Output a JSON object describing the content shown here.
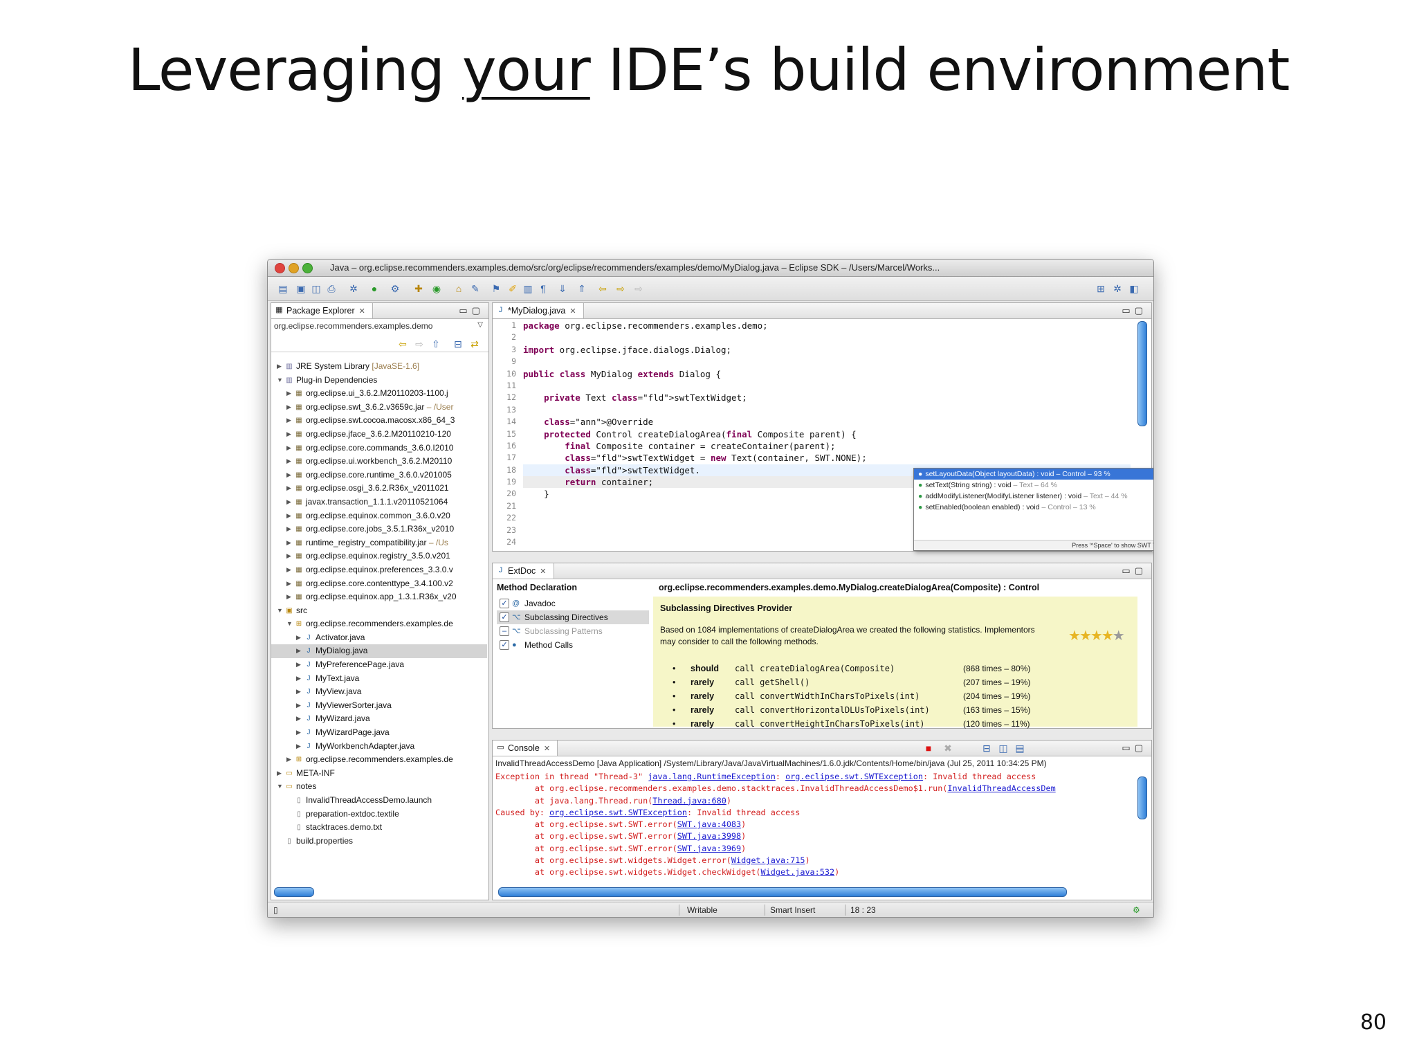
{
  "slide": {
    "title_before": "Leveraging ",
    "title_underlined": "your",
    "title_after": " IDE’s build environment",
    "page_number": "80"
  },
  "window": {
    "title": "Java – org.eclipse.recommenders.examples.demo/src/org/eclipse/recommenders/examples/demo/MyDialog.java – Eclipse SDK – /Users/Marcel/Works..."
  },
  "package_explorer": {
    "tab_label": "Package Explorer",
    "project": "org.eclipse.recommenders.examples.demo",
    "items": [
      {
        "label": "JRE System Library",
        "suffix": " [JavaSE-1.6]",
        "level": 0,
        "arrow": "▶",
        "icon": "library-icon"
      },
      {
        "label": "Plug-in Dependencies",
        "suffix": "",
        "level": 0,
        "arrow": "▼",
        "icon": "library-icon"
      },
      {
        "label": "org.eclipse.ui_3.6.2.M20110203-1100.j",
        "suffix": "",
        "level": 1,
        "arrow": "▶",
        "icon": "jar-icon"
      },
      {
        "label": "org.eclipse.swt_3.6.2.v3659c.jar",
        "suffix": " – /User",
        "level": 1,
        "arrow": "▶",
        "icon": "jar-icon"
      },
      {
        "label": "org.eclipse.swt.cocoa.macosx.x86_64_3",
        "suffix": "",
        "level": 1,
        "arrow": "▶",
        "icon": "jar-icon"
      },
      {
        "label": "org.eclipse.jface_3.6.2.M20110210-120",
        "suffix": "",
        "level": 1,
        "arrow": "▶",
        "icon": "jar-icon"
      },
      {
        "label": "org.eclipse.core.commands_3.6.0.I2010",
        "suffix": "",
        "level": 1,
        "arrow": "▶",
        "icon": "jar-icon"
      },
      {
        "label": "org.eclipse.ui.workbench_3.6.2.M20110",
        "suffix": "",
        "level": 1,
        "arrow": "▶",
        "icon": "jar-icon"
      },
      {
        "label": "org.eclipse.core.runtime_3.6.0.v201005",
        "suffix": "",
        "level": 1,
        "arrow": "▶",
        "icon": "jar-icon"
      },
      {
        "label": "org.eclipse.osgi_3.6.2.R36x_v2011021",
        "suffix": "",
        "level": 1,
        "arrow": "▶",
        "icon": "jar-icon"
      },
      {
        "label": "javax.transaction_1.1.1.v20110521064",
        "suffix": "",
        "level": 1,
        "arrow": "▶",
        "icon": "jar-icon"
      },
      {
        "label": "org.eclipse.equinox.common_3.6.0.v20",
        "suffix": "",
        "level": 1,
        "arrow": "▶",
        "icon": "jar-icon"
      },
      {
        "label": "org.eclipse.core.jobs_3.5.1.R36x_v2010",
        "suffix": "",
        "level": 1,
        "arrow": "▶",
        "icon": "jar-icon"
      },
      {
        "label": "runtime_registry_compatibility.jar",
        "suffix": " – /Us",
        "level": 1,
        "arrow": "▶",
        "icon": "jar-icon"
      },
      {
        "label": "org.eclipse.equinox.registry_3.5.0.v201",
        "suffix": "",
        "level": 1,
        "arrow": "▶",
        "icon": "jar-icon"
      },
      {
        "label": "org.eclipse.equinox.preferences_3.3.0.v",
        "suffix": "",
        "level": 1,
        "arrow": "▶",
        "icon": "jar-icon"
      },
      {
        "label": "org.eclipse.core.contenttype_3.4.100.v2",
        "suffix": "",
        "level": 1,
        "arrow": "▶",
        "icon": "jar-icon"
      },
      {
        "label": "org.eclipse.equinox.app_1.3.1.R36x_v20",
        "suffix": "",
        "level": 1,
        "arrow": "▶",
        "icon": "jar-icon"
      },
      {
        "label": "src",
        "suffix": "",
        "level": 0,
        "arrow": "▼",
        "icon": "source-folder-icon"
      },
      {
        "label": "org.eclipse.recommenders.examples.de",
        "suffix": "",
        "level": 1,
        "arrow": "▼",
        "icon": "package-icon"
      },
      {
        "label": "Activator.java",
        "suffix": "",
        "level": 2,
        "arrow": "▶",
        "icon": "java-file-icon"
      },
      {
        "label": "MyDialog.java",
        "suffix": "",
        "level": 2,
        "arrow": "▶",
        "icon": "java-file-icon",
        "selected": true
      },
      {
        "label": "MyPreferencePage.java",
        "suffix": "",
        "level": 2,
        "arrow": "▶",
        "icon": "java-file-icon"
      },
      {
        "label": "MyText.java",
        "suffix": "",
        "level": 2,
        "arrow": "▶",
        "icon": "java-file-icon"
      },
      {
        "label": "MyView.java",
        "suffix": "",
        "level": 2,
        "arrow": "▶",
        "icon": "java-file-icon"
      },
      {
        "label": "MyViewerSorter.java",
        "suffix": "",
        "level": 2,
        "arrow": "▶",
        "icon": "java-file-icon"
      },
      {
        "label": "MyWizard.java",
        "suffix": "",
        "level": 2,
        "arrow": "▶",
        "icon": "java-file-icon"
      },
      {
        "label": "MyWizardPage.java",
        "suffix": "",
        "level": 2,
        "arrow": "▶",
        "icon": "java-file-icon"
      },
      {
        "label": "MyWorkbenchAdapter.java",
        "suffix": "",
        "level": 2,
        "arrow": "▶",
        "icon": "java-file-icon"
      },
      {
        "label": "org.eclipse.recommenders.examples.de",
        "suffix": "",
        "level": 1,
        "arrow": "▶",
        "icon": "package-icon"
      },
      {
        "label": "META-INF",
        "suffix": "",
        "level": 0,
        "arrow": "▶",
        "icon": "folder-icon"
      },
      {
        "label": "notes",
        "suffix": "",
        "level": 0,
        "arrow": "▼",
        "icon": "folder-icon"
      },
      {
        "label": "InvalidThreadAccessDemo.launch",
        "suffix": "",
        "level": 1,
        "arrow": "",
        "icon": "file-icon"
      },
      {
        "label": "preparation-extdoc.textile",
        "suffix": "",
        "level": 1,
        "arrow": "",
        "icon": "file-icon"
      },
      {
        "label": "stacktraces.demo.txt",
        "suffix": "",
        "level": 1,
        "arrow": "",
        "icon": "file-icon"
      },
      {
        "label": "build.properties",
        "suffix": "",
        "level": 0,
        "arrow": "",
        "icon": "file-icon"
      }
    ]
  },
  "editor": {
    "tab_label": "*MyDialog.java",
    "line_numbers": [
      "1",
      "2",
      "3",
      "9",
      "10",
      "11",
      "12",
      "13",
      "14",
      "15",
      "16",
      "17",
      "18",
      "19",
      "20",
      "21",
      "22",
      "23",
      "24"
    ],
    "lines": [
      "package org.eclipse.recommenders.examples.demo;",
      "",
      "import org.eclipse.jface.dialogs.Dialog;",
      "",
      "public class MyDialog extends Dialog {",
      "",
      "    private Text swtTextWidget;",
      "",
      "    @Override",
      "    protected Control createDialogArea(final Composite parent) {",
      "        final Composite container = createContainer(parent);",
      "        swtTextWidget = new Text(container, SWT.NONE);",
      "        swtTextWidget.",
      "        return container;",
      "    }",
      "",
      "",
      "",
      ""
    ],
    "assist": {
      "items": [
        {
          "sig": "setLayoutData(Object layoutData) : void",
          "meta": " – Control – 93 %"
        },
        {
          "sig": "setText(String string) : void",
          "meta": " – Text – 64 %"
        },
        {
          "sig": "addModifyListener(ModifyListener listener) : void",
          "meta": " – Text – 44 %"
        },
        {
          "sig": "setEnabled(boolean enabled) : void",
          "meta": " – Control – 13 %"
        }
      ],
      "footer": "Press '^Space' to show SWT Template Proposals"
    }
  },
  "extdoc": {
    "tab_label": "ExtDoc",
    "method_declaration_label": "Method Declaration",
    "signature": "org.eclipse.recommenders.examples.demo.MyDialog.createDialogArea(Composite) : Control",
    "providers": [
      {
        "label": "Javadoc",
        "checked": true,
        "icon": "at-icon"
      },
      {
        "label": "Subclassing Directives",
        "checked": true,
        "icon": "tree-icon",
        "selected": true
      },
      {
        "label": "Subclassing Patterns",
        "checked": false,
        "icon": "tree-icon",
        "dim": true
      },
      {
        "label": "Method Calls",
        "checked": true,
        "icon": "dot-icon"
      }
    ],
    "provider_title": "Subclassing Directives Provider",
    "provider_text": "Based on 1084 implementations of createDialogArea we created the following statistics. Implementors may consider to call the following methods.",
    "rating": 4,
    "directives": [
      {
        "quantifier": "should",
        "call": "call createDialogArea(Composite)",
        "stats": "(868 times – 80%)"
      },
      {
        "quantifier": "rarely",
        "call": "call getShell()",
        "stats": "(207 times – 19%)"
      },
      {
        "quantifier": "rarely",
        "call": "call convertWidthInCharsToPixels(int)",
        "stats": "(204 times – 19%)"
      },
      {
        "quantifier": "rarely",
        "call": "call convertHorizontalDLUsToPixels(int)",
        "stats": "(163 times – 15%)"
      },
      {
        "quantifier": "rarely",
        "call": "call convertHeightInCharsToPixels(int)",
        "stats": "(120 times – 11%)"
      }
    ]
  },
  "console": {
    "tab_label": "Console",
    "header": "InvalidThreadAccessDemo [Java Application] /System/Library/Java/JavaVirtualMachines/1.6.0.jdk/Contents/Home/bin/java (Jul 25, 2011 10:34:25 PM)",
    "lines": [
      {
        "pre": "Exception in thread \"Thread-3\" ",
        "link": "java.lang.RuntimeException",
        "mid": ": ",
        "link2": "org.eclipse.swt.SWTException",
        "post": ": Invalid thread access"
      },
      {
        "pre": "        at org.eclipse.recommenders.examples.demo.stacktraces.InvalidThreadAccessDemo$1.run(",
        "link": "InvalidThreadAccessDem",
        "mid": "",
        "link2": "",
        "post": ""
      },
      {
        "pre": "        at java.lang.Thread.run(",
        "link": "Thread.java:680",
        "mid": "",
        "link2": "",
        "post": ")"
      },
      {
        "pre": "Caused by: ",
        "link": "org.eclipse.swt.SWTException",
        "mid": "",
        "link2": "",
        "post": ": Invalid thread access"
      },
      {
        "pre": "        at org.eclipse.swt.SWT.error(",
        "link": "SWT.java:4083",
        "mid": "",
        "link2": "",
        "post": ")"
      },
      {
        "pre": "        at org.eclipse.swt.SWT.error(",
        "link": "SWT.java:3998",
        "mid": "",
        "link2": "",
        "post": ")"
      },
      {
        "pre": "        at org.eclipse.swt.SWT.error(",
        "link": "SWT.java:3969",
        "mid": "",
        "link2": "",
        "post": ")"
      },
      {
        "pre": "        at org.eclipse.swt.widgets.Widget.error(",
        "link": "Widget.java:715",
        "mid": "",
        "link2": "",
        "post": ")"
      },
      {
        "pre": "        at org.eclipse.swt.widgets.Widget.checkWidget(",
        "link": "Widget.java:532",
        "mid": "",
        "link2": "",
        "post": ")"
      }
    ]
  },
  "status": {
    "writable": "Writable",
    "insert_mode": "Smart Insert",
    "cursor": "18 : 23"
  },
  "colors": {
    "keyword": "#7f0055",
    "field": "#0000c0",
    "console_error": "#d21f1f",
    "selection": "#3875d7",
    "extdoc_background": "#f6f6c8"
  }
}
